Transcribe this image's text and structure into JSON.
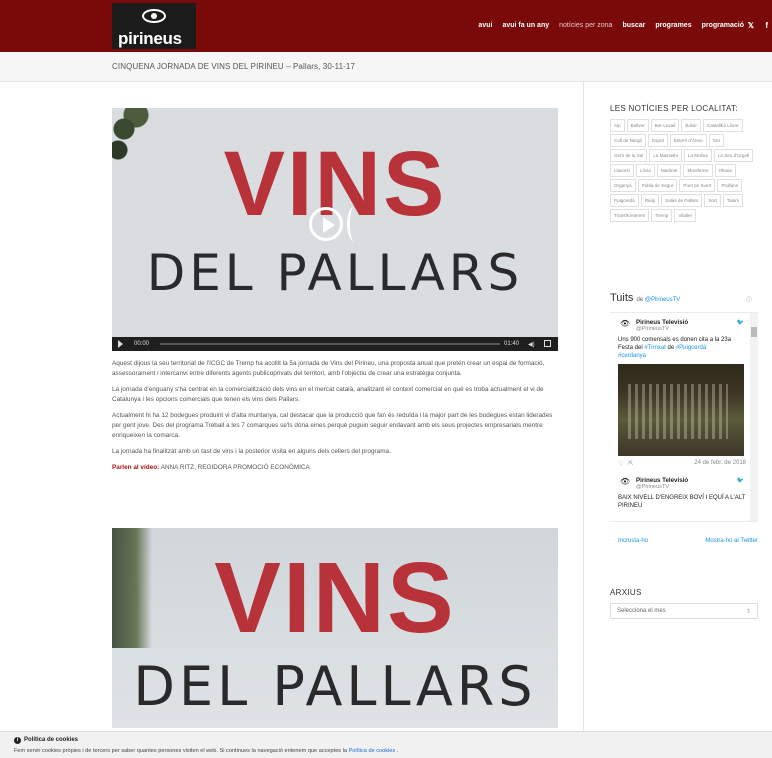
{
  "header": {
    "brand": "pirineus",
    "brand_suffix": "tv",
    "nav": [
      {
        "label": "avui"
      },
      {
        "label": "avui fa un any"
      },
      {
        "label": "notícies per zona"
      },
      {
        "label": "buscar"
      },
      {
        "label": "programes"
      },
      {
        "label": "programació"
      }
    ],
    "social": {
      "twitter": "𝕏",
      "facebook": "f"
    }
  },
  "title": "CINQUENA JORNADA DE VINS DEL PIRINEU – Pallars, 30-11-17",
  "video": {
    "big_text": "VINS",
    "sub_text": "DEL PALLARS",
    "time_current": "00:00",
    "time_total": "01:40"
  },
  "article": {
    "paragraphs": [
      "Aquest dijous la seu territorial de l'ICGC de Tremp ha acollit la 5a jornada de Vins del Pirineu, una proposta anual que pretén crear un espai de formació, assessorament i intercanvi entre diferents agents publicoprivats del territori, amb l'objectiu de crear una estratègia conjunta.",
      "La jornada d'enguany s'ha centrat en la comercialització dels vins en el mercat català, analitzant el context comercial en què es troba actualment el vi de Catalunya i les opcions comercials que tenen els vins dels Pallars.",
      "Actualment hi ha 12 bodegues produint vi d'alta muntanya, cal destacar que la producció que fan és reduïda i la major part de les bodegues estan liderades per gent jove. Des del programa Treball a les 7 comarques se'ls dóna eines perquè puguin seguir endavant amb els seus projectes empresarials mentre enriqueixen la comarca.",
      "La jornada ha finalitzat amb un tast de vins i la posterior visita en alguns dels cellers del programa."
    ],
    "speakers_label": "Parlen al vídeo:",
    "speakers": "ANNA RITZ, REGIDORA PROMOCIÓ ECONÒMICA"
  },
  "video2": {
    "big_text": "VINS",
    "sub_text": "DEL PALLARS"
  },
  "sidebar": {
    "locations_title": "LES NOTÍCIES PER LOCALITAT:",
    "locations": [
      "Alp",
      "Bellver",
      "Bor-Lavall",
      "Bolvir",
      "Castellbò Lliure",
      "Coll de Nargó",
      "Espot",
      "Esterri d'Àneu",
      "Ger",
      "Gerri de la Sal",
      "La Massella",
      "La Molina",
      "La Seu d'Urgell",
      "Llavorsí",
      "Llívia",
      "Martinet",
      "Montferrer",
      "Oliana",
      "Organyà",
      "Pobla de Segur",
      "Pont de Suert",
      "Prullans",
      "Puigcerdà",
      "Rialp",
      "Salàs de Pallars",
      "Sort",
      "Talarn",
      "Transfronterers",
      "Tremp",
      "Vilaller"
    ],
    "twitter": {
      "title": "Tuits",
      "by": "de",
      "handle": "@PirineusTV",
      "tweets": [
        {
          "name": "Pirineus Televisió",
          "handle": "@PirineusTV",
          "text_before": "Uns 900 comensals es donen cita a la 23a Festa del ",
          "tag1": "#Trinxat",
          "text_mid": " de ",
          "tag2": "#Puigcerdà",
          "tag3": "#cerdanya",
          "date": "24 de febr. de 2018"
        },
        {
          "name": "Pirineus Televisió",
          "handle": "@PirineusTV",
          "text": "BAIX NIVELL D'ENGREIX BOVÍ I EQUÍ A L'ALT PIRINEU"
        }
      ],
      "embed_label": "Incrusta-ho",
      "view_label": "Mostra-ho al Twitter"
    },
    "archive_title": "ARXIUS",
    "archive_select": "Selecciona el mes"
  },
  "cookies": {
    "title": "Política de cookies",
    "message": "Fem servir cookies pròpies i de tercers per saber quantes persones visiten el web. Si continues la navegació entenem que acceptes la ",
    "link": "Política de cookies",
    "end": " ."
  }
}
